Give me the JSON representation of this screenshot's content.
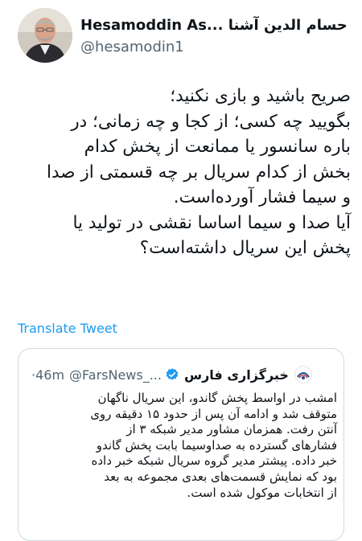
{
  "author": {
    "display_name": "Hesamoddin As... حسام الدین آشنا",
    "handle": "@hesamodin1"
  },
  "tweet": {
    "lines": [
      "صریح باشید و بازی نکنید؛",
      "بگویید چه کسی؛ از کجا و چه زمانی؛ در",
      "باره سانسور یا ممانعت از پخش کدام",
      "بخش از کدام سریال بر چه قسمتی از صدا",
      "و سیما فشار آورده‌است.",
      "آیا صدا و سیما اساسا نقشی در تولید یا",
      "پخش این سریال داشته‌است؟"
    ]
  },
  "translate_label": "Translate Tweet",
  "quoted": {
    "name": "خبرگزاری فارس",
    "handle": "@FarsNews_...",
    "time": "·46m",
    "lines": [
      "امشب در اواسط پخش گاندو، این سریال ناگهان",
      "متوقف شد و ادامه آن پس از حدود ۱۵ دقیقه روی",
      "آنتن رفت. همزمان مشاور مدیر شبکه ۳ از",
      "فشارهای گسترده به صداوسیما بابت پخش گاندو",
      "خبر داده. پیشتر مدیر گروه سریال شبکه خبر داده",
      "بود که نمایش قسمت‌های بعدی مجموعه به بعد",
      "از انتخابات موکول شده است."
    ]
  },
  "colors": {
    "link": "#1d9bf0",
    "secondary_text": "#536471",
    "border": "#cfd9de",
    "verified": "#1d9bf0"
  },
  "icons": {
    "verified": "verified-badge-icon",
    "news_logo": "news-agency-logo-icon"
  }
}
